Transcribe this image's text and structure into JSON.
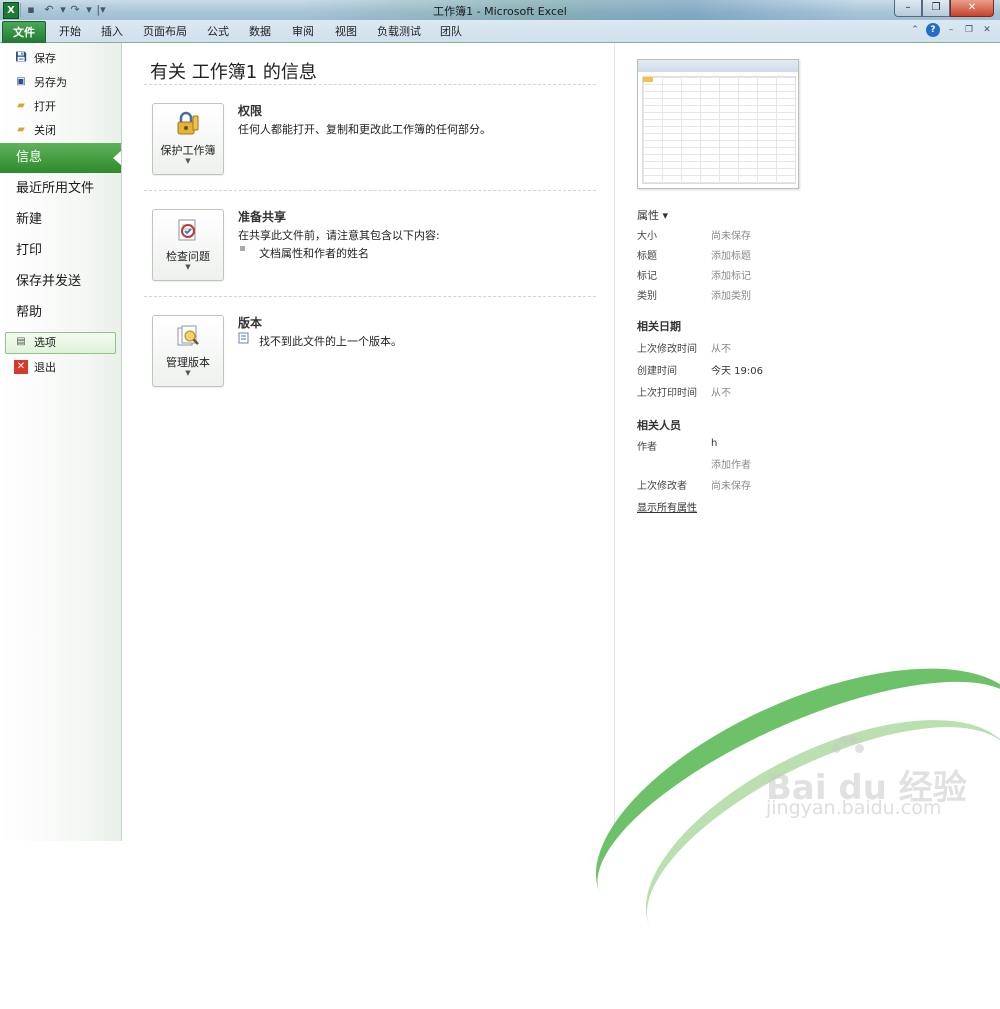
{
  "window": {
    "title": "工作簿1  -  Microsoft Excel",
    "app_icon": "X",
    "controls": [
      "minimize-icon",
      "restore-icon",
      "close-icon"
    ]
  },
  "ribbon": {
    "tabs": [
      "文件",
      "开始",
      "插入",
      "页面布局",
      "公式",
      "数据",
      "审阅",
      "视图",
      "负载测试",
      "团队"
    ]
  },
  "nav": {
    "small_top": [
      {
        "label": "保存",
        "icon": "save-icon"
      },
      {
        "label": "另存为",
        "icon": "save-as-icon"
      },
      {
        "label": "打开",
        "icon": "open-folder-icon"
      },
      {
        "label": "关闭",
        "icon": "close-folder-icon"
      }
    ],
    "big": [
      {
        "label": "信息",
        "active": true
      },
      {
        "label": "最近所用文件"
      },
      {
        "label": "新建"
      },
      {
        "label": "打印"
      },
      {
        "label": "保存并发送"
      },
      {
        "label": "帮助"
      }
    ],
    "small_bottom": [
      {
        "label": "选项",
        "icon": "options-icon"
      },
      {
        "label": "退出",
        "icon": "exit-icon"
      }
    ]
  },
  "main": {
    "title": "有关 工作簿1 的信息",
    "sections": [
      {
        "button_label": "保护工作簿",
        "title": "权限",
        "lines": [
          "任何人都能打开、复制和更改此工作簿的任何部分。"
        ]
      },
      {
        "button_label": "检查问题",
        "title": "准备共享",
        "lines": [
          "在共享此文件前，请注意其包含以下内容:"
        ],
        "bullets": [
          "文档属性和作者的姓名"
        ]
      },
      {
        "button_label": "管理版本",
        "title": "版本",
        "lines": [
          "找不到此文件的上一个版本。"
        ]
      }
    ]
  },
  "properties": {
    "header": "属性 ▾",
    "items": [
      {
        "key": "大小",
        "value": "尚未保存"
      },
      {
        "key": "标题",
        "value": "添加标题"
      },
      {
        "key": "标记",
        "value": "添加标记"
      },
      {
        "key": "类别",
        "value": "添加类别"
      }
    ],
    "dates_header": "相关日期",
    "dates": [
      {
        "key": "上次修改时间",
        "value": "从不"
      },
      {
        "key": "创建时间",
        "value": "今天 19:06"
      },
      {
        "key": "上次打印时间",
        "value": "从不"
      }
    ],
    "people_header": "相关人员",
    "people": [
      {
        "key": "作者",
        "value": "h"
      },
      {
        "key": "",
        "value": "添加作者"
      },
      {
        "key": "上次修改者",
        "value": "尚未保存"
      }
    ],
    "show_all": "显示所有属性"
  },
  "watermark": {
    "brand": "Bai du 经验",
    "url": "jingyan.baidu.com"
  }
}
